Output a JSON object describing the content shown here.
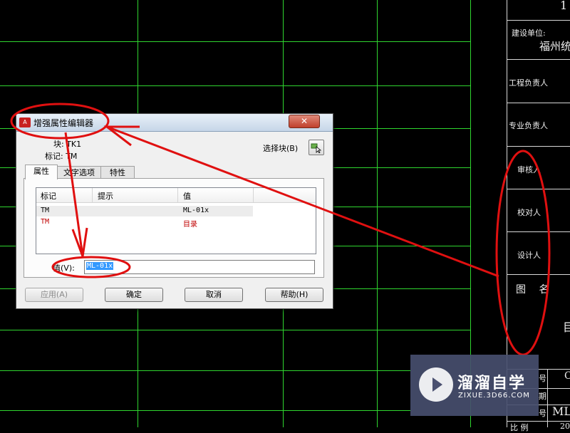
{
  "title_block": {
    "corner_digit": "1",
    "builder_label": "建设单位:",
    "builder_value": "福州统",
    "engineer_label": "工程负责人",
    "specialty_label": "专业负责人",
    "review_label": "审核人",
    "checker_label": "校对人",
    "designer_label": "设计人",
    "drawing_name_label": "图 名",
    "drawing_name_value": "目",
    "row_a_label": "号",
    "row_a_value": "C",
    "row_b_label": "期",
    "row_c_label": "号",
    "row_c_value": "ML",
    "row_d_label": "比 例",
    "row_d_value": "20"
  },
  "dialog": {
    "title": "增强属性编辑器",
    "close_label": "✕",
    "block_label": "块: TK1",
    "tag_label": "标记: TM",
    "select_block_label": "选择块(B)",
    "tabs": [
      {
        "label": "属性"
      },
      {
        "label": "文字选项"
      },
      {
        "label": "特性"
      }
    ],
    "grid": {
      "columns": [
        "标记",
        "提示",
        "值"
      ],
      "rows": [
        {
          "tag": "TM",
          "prompt": "",
          "value": "ML-01x"
        },
        {
          "tag": "TM",
          "prompt": "",
          "value": "目录"
        }
      ]
    },
    "value_label": "值(V):",
    "value_text": "ML-01x",
    "buttons": {
      "apply": "应用(A)",
      "ok": "确定",
      "cancel": "取消",
      "help": "帮助(H)"
    }
  },
  "watermark": {
    "title": "溜溜自学",
    "subtitle": "ZIXUE.3D66.COM"
  },
  "colors": {
    "background": "#000000",
    "grid_line": "#2fd62f",
    "annotation": "#e01010",
    "selection": "#3399ff"
  }
}
